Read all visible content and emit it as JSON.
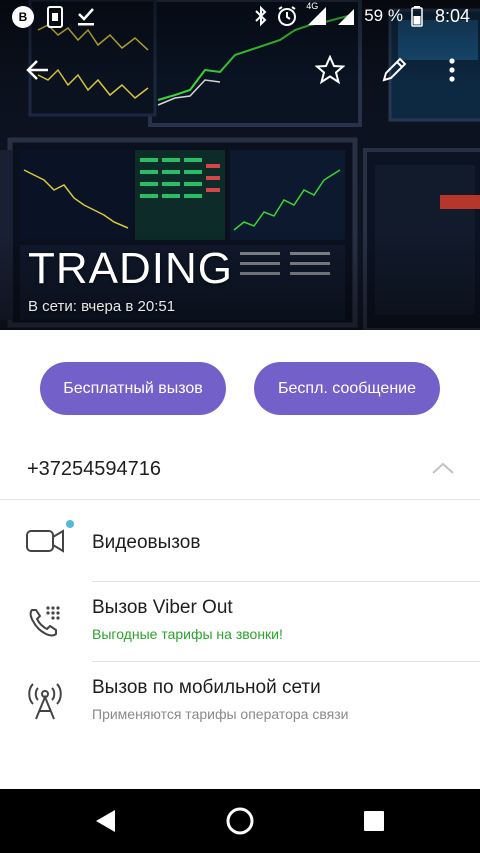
{
  "status_bar": {
    "battery_percent": "59 %",
    "time": "8:04",
    "network_type": "4G",
    "notification_icons": [
      "b-badge-icon",
      "sim-icon",
      "download-done-icon"
    ],
    "system_icons": [
      "bluetooth-icon",
      "alarm-icon",
      "signal-icon",
      "signal-icon-2",
      "battery-icon"
    ]
  },
  "header": {
    "contact_name": "TRADING",
    "online_status": "В сети: вчера в 20:51",
    "actions": [
      "back-arrow-icon",
      "star-icon",
      "pencil-icon",
      "more-vert-icon"
    ]
  },
  "buttons": {
    "free_call": "Бесплатный вызов",
    "free_message": "Беспл. сообщение"
  },
  "phone": {
    "number": "+37254594716"
  },
  "actions": {
    "video": {
      "title": "Видеовызов"
    },
    "viber_out": {
      "title": "Вызов Viber Out",
      "subtitle": "Выгодные тарифы на звонки!"
    },
    "mobile": {
      "title": "Вызов по мобильной сети",
      "subtitle": "Применяются тарифы оператора связи"
    }
  },
  "colors": {
    "accent": "#7360c8",
    "viber_out_green": "#2aa52a",
    "new_dot": "#54b9d6"
  }
}
